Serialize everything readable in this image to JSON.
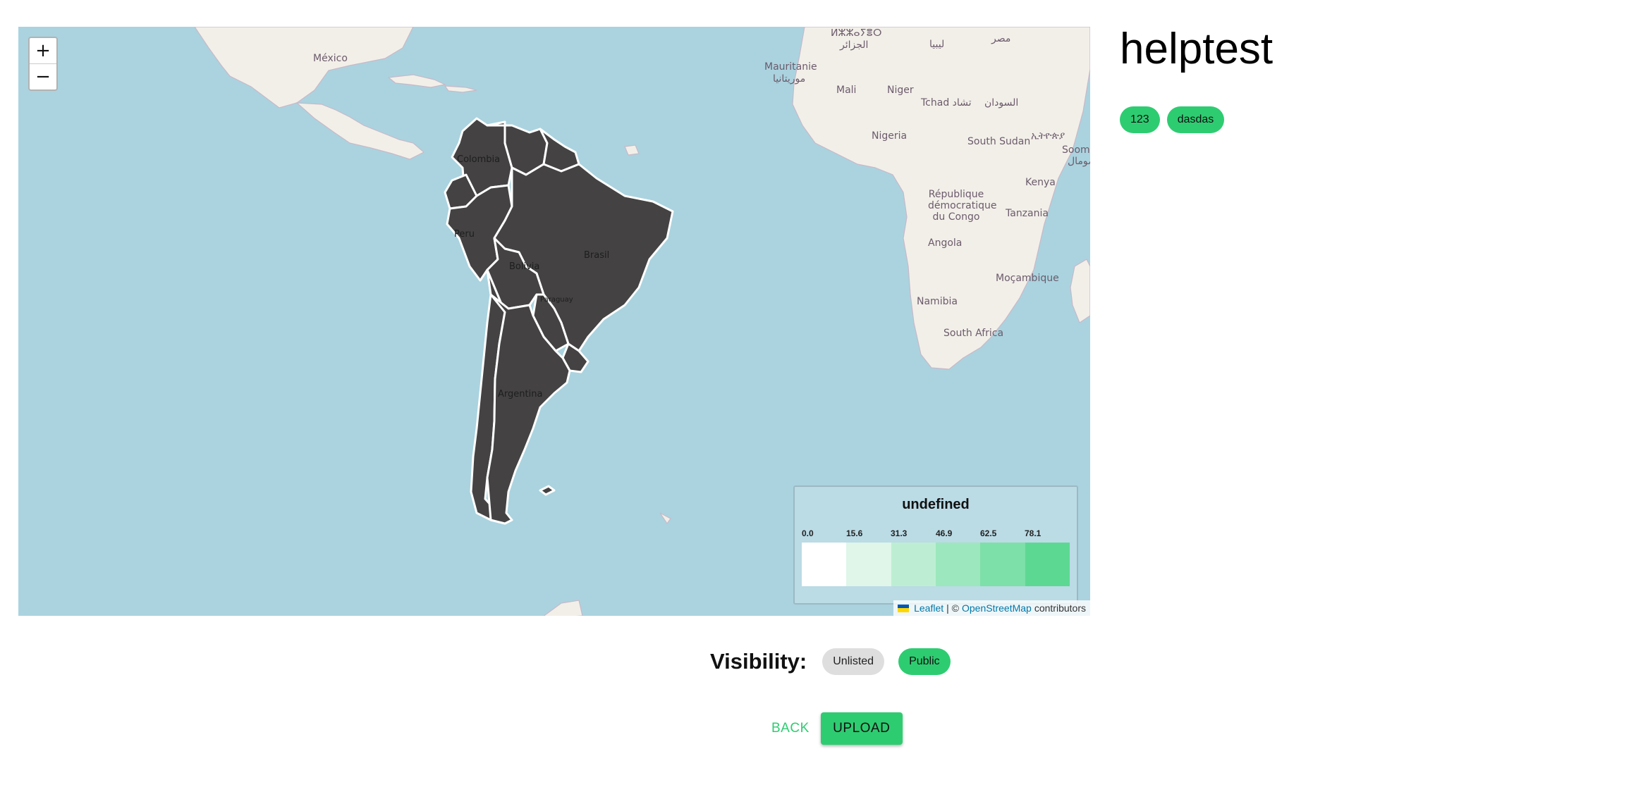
{
  "page": {
    "title": "helptest"
  },
  "tags": [
    "123",
    "dasdas"
  ],
  "map": {
    "zoom_in": "+",
    "zoom_out": "−",
    "colors": {
      "ocean": "#aad3df",
      "land": "#f2efe9",
      "choropleth": "#444242"
    },
    "labels": {
      "mexico": "México",
      "mauritanie": "Mauritanie",
      "mauritanie_ar": "موريتانيا",
      "mali": "Mali",
      "niger": "Niger",
      "tchad": "Tchad تشاد",
      "libya": "ليبيا",
      "egypt": "مصر",
      "sudan": "السودان",
      "algeria_tf": "ⵍⵣⵣⴰⵢⴻⵔ",
      "algeria_ar": "الجزائر",
      "nigeria": "Nigeria",
      "south_sudan": "South Sudan",
      "ethiopia": "ኢትዮጵያ",
      "somalia": "Soomaaliya",
      "somalia_ar": "الصومال",
      "kenya": "Kenya",
      "drc": "République démocratique du Congo",
      "tanzania": "Tanzania",
      "angola": "Angola",
      "mozambique": "Moçambique",
      "namibia": "Namibia",
      "south_africa": "South Africa",
      "colombia": "Colombia",
      "peru": "Peru",
      "bolivia": "Bolivia",
      "brasil": "Brasil",
      "paraguay": "Paraguay",
      "argentina": "Argentina"
    }
  },
  "legend": {
    "title": "undefined",
    "ticks": [
      "0.0",
      "15.6",
      "31.3",
      "46.9",
      "62.5",
      "78.1"
    ],
    "colors": [
      "#ffffff",
      "#dff6e9",
      "#bdeed3",
      "#9ce7bd",
      "#7de0a8",
      "#5dd893"
    ]
  },
  "attribution": {
    "leaflet": "Leaflet",
    "separator": "| ©",
    "osm": "OpenStreetMap",
    "contributors": "contributors"
  },
  "visibility": {
    "label": "Visibility:",
    "options": [
      "Unlisted",
      "Public"
    ],
    "selected": "Public"
  },
  "actions": {
    "back": "BACK",
    "upload": "UPLOAD"
  }
}
